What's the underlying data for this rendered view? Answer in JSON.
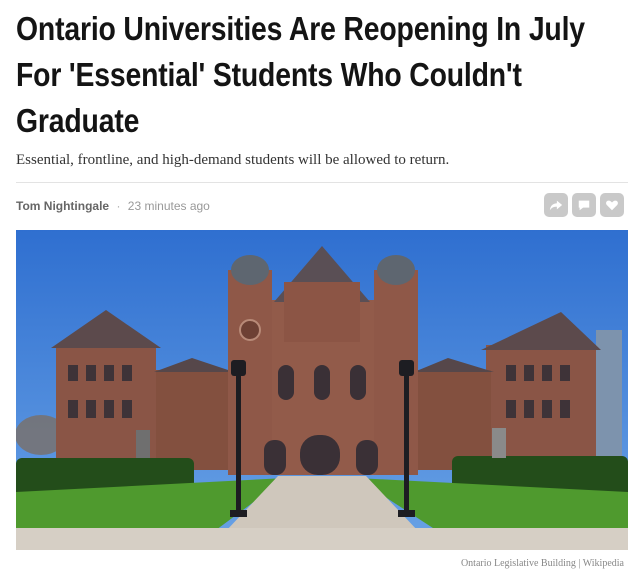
{
  "article": {
    "headline_line1": "Ontario Universities Are Reopening In July",
    "headline_line2": "For 'Essential' Students Who Couldn't",
    "headline_line3": "Graduate",
    "subheadline": "Essential, frontline, and high-demand students will be allowed to return.",
    "author": "Tom Nightingale",
    "separator": "·",
    "published": "23 minutes ago",
    "share_icons": [
      "share-arrow-icon",
      "comment-icon",
      "heart-icon"
    ],
    "image_caption": "Ontario Legislative Building | Wikipedia"
  },
  "colors": {
    "sky": "#3d7fd6",
    "stone": "#8a5546",
    "grass": "#4f9a2e",
    "share_button": "#c9c9c9"
  }
}
